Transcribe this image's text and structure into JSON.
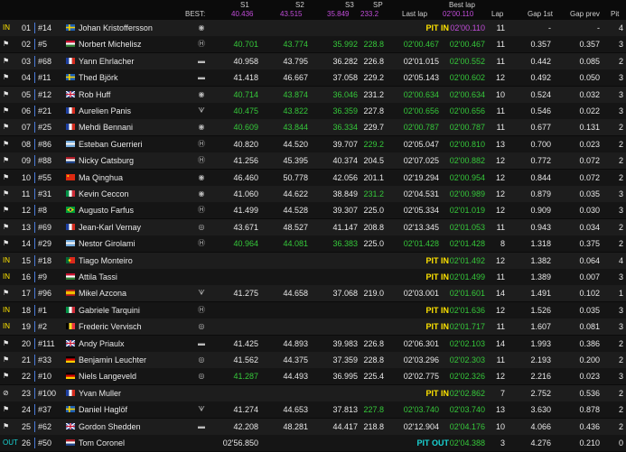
{
  "header": {
    "best_label": "BEST:",
    "s1": "S1",
    "s2": "S2",
    "s3": "S3",
    "sp": "SP",
    "best_s1": "40.436",
    "best_s2": "43.515",
    "best_s3": "35.849",
    "best_sp": "233.2",
    "last_lap": "Last lap",
    "best_lap_top": "Best lap",
    "best_lap_value": "02'00.110",
    "lap": "Lap",
    "gap_1st": "Gap 1st",
    "gap_prev": "Gap prev",
    "pit": "Pit"
  },
  "colors": {
    "background": "#0b0b0b",
    "row_odd": "#1d1d1d",
    "row_even": "#151515",
    "personal_best": "#35c83a",
    "overall_best": "#c04cd8",
    "pit_status": "#ffe400",
    "pit_out": "#19d4d4",
    "separator": "#4a7bd8"
  },
  "rows": [
    {
      "flag": "IN",
      "pos": "01",
      "num": "#14",
      "nat": "Sweden",
      "name": "Johan Kristoffersson",
      "car": "◉",
      "s1": "",
      "s2": "",
      "s3": "",
      "sp": "",
      "last": "PIT IN",
      "best": "02'00.110",
      "lap": "11",
      "gap1": "-",
      "gapp": "-",
      "pit": "4",
      "status": "pit-in",
      "best_cls": "best-purple"
    },
    {
      "flag": "⚑",
      "pos": "02",
      "num": "#5",
      "nat": "Hungary",
      "name": "Norbert Michelisz",
      "car": "Ⓗ",
      "s1": "40.701",
      "s2": "43.774",
      "s3": "35.992",
      "sp": "228.8",
      "last": "02'00.467",
      "best": "02'00.467",
      "lap": "11",
      "gap1": "0.357",
      "gapp": "0.357",
      "pit": "3",
      "s1_cls": "best-green",
      "s2_cls": "best-green",
      "s3_cls": "best-green",
      "sp_cls": "best-green",
      "last_cls": "best-green",
      "best_cls": "best-green"
    },
    {
      "flag": "⚑",
      "pos": "03",
      "num": "#68",
      "nat": "France",
      "name": "Yann Ehrlacher",
      "car": "▬",
      "s1": "40.958",
      "s2": "43.795",
      "s3": "36.282",
      "sp": "226.8",
      "last": "02'01.015",
      "best": "02'00.552",
      "lap": "11",
      "gap1": "0.442",
      "gapp": "0.085",
      "pit": "2",
      "best_cls": "best-green"
    },
    {
      "flag": "⚑",
      "pos": "04",
      "num": "#11",
      "nat": "Sweden",
      "name": "Thed Björk",
      "car": "▬",
      "s1": "41.418",
      "s2": "46.667",
      "s3": "37.058",
      "sp": "229.2",
      "last": "02'05.143",
      "best": "02'00.602",
      "lap": "12",
      "gap1": "0.492",
      "gapp": "0.050",
      "pit": "3",
      "best_cls": "best-green"
    },
    {
      "flag": "⚑",
      "pos": "05",
      "num": "#12",
      "nat": "UK",
      "name": "Rob Huff",
      "car": "◉",
      "s1": "40.714",
      "s2": "43.874",
      "s3": "36.046",
      "sp": "231.2",
      "last": "02'00.634",
      "best": "02'00.634",
      "lap": "10",
      "gap1": "0.524",
      "gapp": "0.032",
      "pit": "3",
      "s1_cls": "best-green",
      "s2_cls": "best-green",
      "s3_cls": "best-green",
      "last_cls": "best-green",
      "best_cls": "best-green"
    },
    {
      "flag": "⚑",
      "pos": "06",
      "num": "#21",
      "nat": "France",
      "name": "Aurelien Panis",
      "car": "ᗐ",
      "s1": "40.475",
      "s2": "43.822",
      "s3": "36.359",
      "sp": "227.8",
      "last": "02'00.656",
      "best": "02'00.656",
      "lap": "11",
      "gap1": "0.546",
      "gapp": "0.022",
      "pit": "3",
      "s1_cls": "best-green",
      "s2_cls": "best-green",
      "s3_cls": "best-green",
      "last_cls": "best-green",
      "best_cls": "best-green"
    },
    {
      "flag": "⚑",
      "pos": "07",
      "num": "#25",
      "nat": "France",
      "name": "Mehdi Bennani",
      "car": "◉",
      "s1": "40.609",
      "s2": "43.844",
      "s3": "36.334",
      "sp": "229.7",
      "last": "02'00.787",
      "best": "02'00.787",
      "lap": "11",
      "gap1": "0.677",
      "gapp": "0.131",
      "pit": "2",
      "s1_cls": "best-green",
      "s2_cls": "best-green",
      "s3_cls": "best-green",
      "last_cls": "best-green",
      "best_cls": "best-green"
    },
    {
      "flag": "⚑",
      "pos": "08",
      "num": "#86",
      "nat": "Argentina",
      "name": "Esteban Guerrieri",
      "car": "Ⓗ",
      "s1": "40.820",
      "s2": "44.520",
      "s3": "39.707",
      "sp": "229.2",
      "last": "02'05.047",
      "best": "02'00.810",
      "lap": "13",
      "gap1": "0.700",
      "gapp": "0.023",
      "pit": "2",
      "sp_cls": "best-green",
      "best_cls": "best-green"
    },
    {
      "flag": "⚑",
      "pos": "09",
      "num": "#88",
      "nat": "Netherlands",
      "name": "Nicky Catsburg",
      "car": "Ⓗ",
      "s1": "41.256",
      "s2": "45.395",
      "s3": "40.374",
      "sp": "204.5",
      "last": "02'07.025",
      "best": "02'00.882",
      "lap": "12",
      "gap1": "0.772",
      "gapp": "0.072",
      "pit": "2",
      "best_cls": "best-green"
    },
    {
      "flag": "⚑",
      "pos": "10",
      "num": "#55",
      "nat": "China",
      "name": "Ma Qinghua",
      "car": "◉",
      "s1": "46.460",
      "s2": "50.778",
      "s3": "42.056",
      "sp": "201.1",
      "last": "02'19.294",
      "best": "02'00.954",
      "lap": "12",
      "gap1": "0.844",
      "gapp": "0.072",
      "pit": "2",
      "best_cls": "best-green"
    },
    {
      "flag": "⚑",
      "pos": "11",
      "num": "#31",
      "nat": "Italy",
      "name": "Kevin Ceccon",
      "car": "◉",
      "s1": "41.060",
      "s2": "44.622",
      "s3": "38.849",
      "sp": "231.2",
      "last": "02'04.531",
      "best": "02'00.989",
      "lap": "12",
      "gap1": "0.879",
      "gapp": "0.035",
      "pit": "3",
      "sp_cls": "best-green",
      "best_cls": "best-green"
    },
    {
      "flag": "⚑",
      "pos": "12",
      "num": "#8",
      "nat": "Brazil",
      "name": "Augusto Farfus",
      "car": "Ⓗ",
      "s1": "41.499",
      "s2": "44.528",
      "s3": "39.307",
      "sp": "225.0",
      "last": "02'05.334",
      "best": "02'01.019",
      "lap": "12",
      "gap1": "0.909",
      "gapp": "0.030",
      "pit": "3",
      "best_cls": "best-green"
    },
    {
      "flag": "⚑",
      "pos": "13",
      "num": "#69",
      "nat": "France",
      "name": "Jean-Karl Vernay",
      "car": "◎",
      "s1": "43.671",
      "s2": "48.527",
      "s3": "41.147",
      "sp": "208.8",
      "last": "02'13.345",
      "best": "02'01.053",
      "lap": "11",
      "gap1": "0.943",
      "gapp": "0.034",
      "pit": "2",
      "best_cls": "best-green"
    },
    {
      "flag": "⚑",
      "pos": "14",
      "num": "#29",
      "nat": "Argentina",
      "name": "Nestor Girolami",
      "car": "Ⓗ",
      "s1": "40.964",
      "s2": "44.081",
      "s3": "36.383",
      "sp": "225.0",
      "last": "02'01.428",
      "best": "02'01.428",
      "lap": "8",
      "gap1": "1.318",
      "gapp": "0.375",
      "pit": "2",
      "s1_cls": "best-green",
      "s2_cls": "best-green",
      "s3_cls": "best-green",
      "last_cls": "best-green",
      "best_cls": "best-green"
    },
    {
      "flag": "IN",
      "pos": "15",
      "num": "#18",
      "nat": "Portugal",
      "name": "Tiago Monteiro",
      "car": "",
      "s1": "",
      "s2": "",
      "s3": "",
      "sp": "",
      "last": "PIT IN",
      "best": "02'01.492",
      "lap": "12",
      "gap1": "1.382",
      "gapp": "0.064",
      "pit": "4",
      "status": "pit-in",
      "best_cls": "best-green"
    },
    {
      "flag": "IN",
      "pos": "16",
      "num": "#9",
      "nat": "Hungary",
      "name": "Attila Tassi",
      "car": "",
      "s1": "",
      "s2": "",
      "s3": "",
      "sp": "",
      "last": "PIT IN",
      "best": "02'01.499",
      "lap": "11",
      "gap1": "1.389",
      "gapp": "0.007",
      "pit": "3",
      "status": "pit-in",
      "best_cls": "best-green"
    },
    {
      "flag": "⚑",
      "pos": "17",
      "num": "#96",
      "nat": "Spain",
      "name": "Mikel Azcona",
      "car": "ᗐ",
      "s1": "41.275",
      "s2": "44.658",
      "s3": "37.068",
      "sp": "219.0",
      "last": "02'03.001",
      "best": "02'01.601",
      "lap": "14",
      "gap1": "1.491",
      "gapp": "0.102",
      "pit": "1",
      "best_cls": "best-green"
    },
    {
      "flag": "IN",
      "pos": "18",
      "num": "#1",
      "nat": "Italy",
      "name": "Gabriele Tarquini",
      "car": "Ⓗ",
      "s1": "",
      "s2": "",
      "s3": "",
      "sp": "",
      "last": "PIT IN",
      "best": "02'01.636",
      "lap": "12",
      "gap1": "1.526",
      "gapp": "0.035",
      "pit": "3",
      "status": "pit-in",
      "best_cls": "best-green"
    },
    {
      "flag": "IN",
      "pos": "19",
      "num": "#2",
      "nat": "Belgium",
      "name": "Frederic Vervisch",
      "car": "◎",
      "s1": "",
      "s2": "",
      "s3": "",
      "sp": "",
      "last": "PIT IN",
      "best": "02'01.717",
      "lap": "11",
      "gap1": "1.607",
      "gapp": "0.081",
      "pit": "3",
      "status": "pit-in",
      "best_cls": "best-green"
    },
    {
      "flag": "⚑",
      "pos": "20",
      "num": "#111",
      "nat": "UK",
      "name": "Andy Priaulx",
      "car": "▬",
      "s1": "41.425",
      "s2": "44.893",
      "s3": "39.983",
      "sp": "226.8",
      "last": "02'06.301",
      "best": "02'02.103",
      "lap": "14",
      "gap1": "1.993",
      "gapp": "0.386",
      "pit": "2",
      "best_cls": "best-green"
    },
    {
      "flag": "⚑",
      "pos": "21",
      "num": "#33",
      "nat": "Germany",
      "name": "Benjamin Leuchter",
      "car": "◎",
      "s1": "41.562",
      "s2": "44.375",
      "s3": "37.359",
      "sp": "228.8",
      "last": "02'03.296",
      "best": "02'02.303",
      "lap": "11",
      "gap1": "2.193",
      "gapp": "0.200",
      "pit": "2",
      "best_cls": "best-green"
    },
    {
      "flag": "⚑",
      "pos": "22",
      "num": "#10",
      "nat": "Germany",
      "name": "Niels Langeveld",
      "car": "◎",
      "s1": "41.287",
      "s2": "44.493",
      "s3": "36.995",
      "sp": "225.4",
      "last": "02'02.775",
      "best": "02'02.326",
      "lap": "12",
      "gap1": "2.216",
      "gapp": "0.023",
      "pit": "3",
      "s1_cls": "best-green",
      "best_cls": "best-green"
    },
    {
      "flag": "⊘",
      "pos": "23",
      "num": "#100",
      "nat": "France",
      "name": "Yvan Muller",
      "car": "",
      "s1": "",
      "s2": "",
      "s3": "",
      "sp": "",
      "last": "PIT IN",
      "best": "02'02.862",
      "lap": "7",
      "gap1": "2.752",
      "gapp": "0.536",
      "pit": "2",
      "status": "pit-in",
      "best_cls": "best-green"
    },
    {
      "flag": "⚑",
      "pos": "24",
      "num": "#37",
      "nat": "Sweden",
      "name": "Daniel Haglöf",
      "car": "ᗐ",
      "s1": "41.274",
      "s2": "44.653",
      "s3": "37.813",
      "sp": "227.8",
      "last": "02'03.740",
      "best": "02'03.740",
      "lap": "13",
      "gap1": "3.630",
      "gapp": "0.878",
      "pit": "2",
      "sp_cls": "best-green",
      "last_cls": "best-green",
      "best_cls": "best-green"
    },
    {
      "flag": "⚑",
      "pos": "25",
      "num": "#62",
      "nat": "UK",
      "name": "Gordon Shedden",
      "car": "▬",
      "s1": "42.208",
      "s2": "48.281",
      "s3": "44.417",
      "sp": "218.8",
      "last": "02'12.904",
      "best": "02'04.176",
      "lap": "10",
      "gap1": "4.066",
      "gapp": "0.436",
      "pit": "2",
      "best_cls": "best-green"
    },
    {
      "flag": "OUT",
      "pos": "26",
      "num": "#50",
      "nat": "Netherlands",
      "name": "Tom Coronel",
      "car": "",
      "s1": "02'56.850",
      "s2": "",
      "s3": "",
      "sp": "",
      "last": "PIT OUT",
      "best": "02'04.388",
      "lap": "3",
      "gap1": "4.276",
      "gapp": "0.210",
      "pit": "0",
      "status": "pit-out",
      "best_cls": "best-green"
    }
  ]
}
